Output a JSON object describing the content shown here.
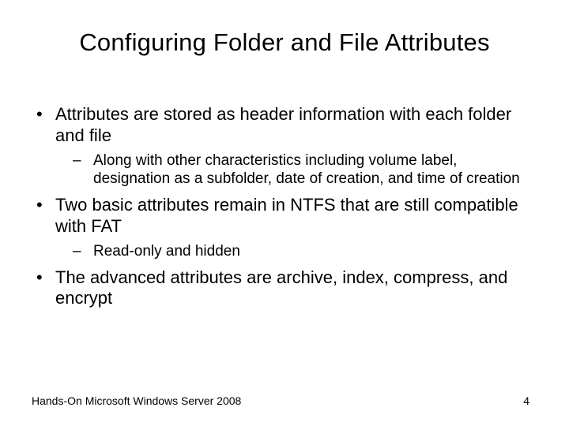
{
  "title": "Configuring Folder and File Attributes",
  "bullets": [
    {
      "text": "Attributes are stored as header information with each folder and file",
      "sub": [
        "Along with other characteristics including volume label, designation as a subfolder, date of creation, and time of creation"
      ]
    },
    {
      "text": "Two basic attributes remain in NTFS that are still compatible with FAT",
      "sub": [
        "Read-only and hidden"
      ]
    },
    {
      "text": "The advanced attributes are archive, index, compress, and encrypt",
      "sub": []
    }
  ],
  "footer": {
    "left": "Hands-On Microsoft Windows Server 2008",
    "right": "4"
  }
}
